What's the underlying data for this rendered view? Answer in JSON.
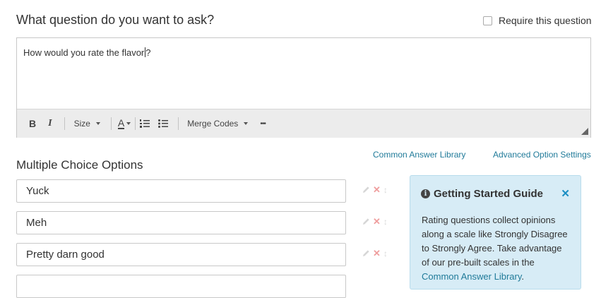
{
  "question": {
    "prompt": "What question do you want to ask?",
    "require_label": "Require this question",
    "text": "How would you rate the flavor",
    "text_tail": "?"
  },
  "toolbar": {
    "bold": "B",
    "italic": "I",
    "size_label": "Size",
    "font_color_label": "A",
    "merge_codes_label": "Merge Codes",
    "more_label": "•••"
  },
  "links": {
    "common_answer_library": "Common Answer Library",
    "advanced_option_settings": "Advanced Option Settings"
  },
  "options_section": {
    "title": "Multiple Choice Options",
    "options": [
      "Yuck",
      "Meh",
      "Pretty darn good"
    ]
  },
  "guide": {
    "title": "Getting Started Guide",
    "close": "✕",
    "body": "Rating questions collect opinions along a scale like Strongly Disagree to Strongly Agree. Take advantage of our pre-built scales in the ",
    "link": "Common Answer Library",
    "tail": "."
  },
  "colors": {
    "link": "#1f7a99",
    "guide_background": "#d7ecf6",
    "delete_icon": "#ef9e9e"
  },
  "icons": [
    "checkbox-icon",
    "bold-icon",
    "italic-icon",
    "font-color-icon",
    "numbered-list-icon",
    "bulleted-list-icon",
    "more-icon",
    "resize-icon",
    "pencil-icon",
    "delete-icon",
    "drag-handle-icon",
    "info-icon",
    "close-icon"
  ]
}
